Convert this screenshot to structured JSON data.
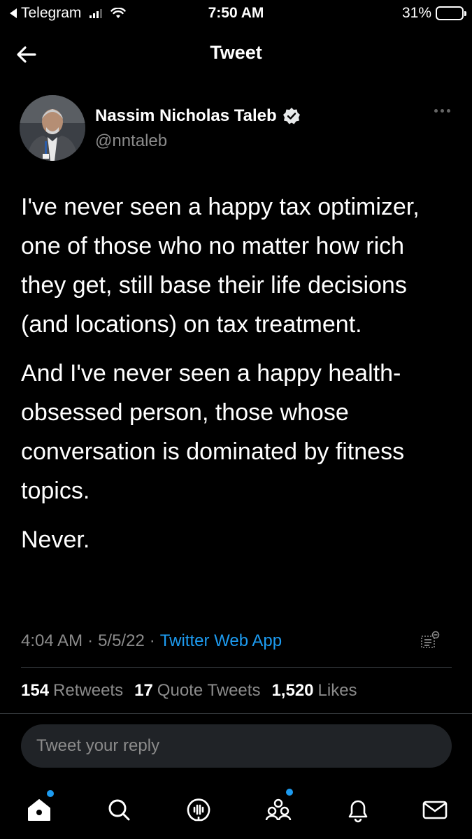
{
  "status_bar": {
    "back_app": "Telegram",
    "time": "7:50 AM",
    "battery": "31%",
    "battery_level": 0.31,
    "signal_bars": 3
  },
  "nav": {
    "title": "Tweet",
    "back_icon": "arrow-left-icon"
  },
  "author": {
    "name": "Nassim Nicholas Taleb",
    "handle": "@nntaleb",
    "verified": true
  },
  "tweet": {
    "paragraphs": [
      "I've never seen a happy tax optimizer, one of those who no matter how rich they get, still base their life decisions (and locations) on tax treatment.",
      "And I've never seen a happy health-obsessed person, those whose conversation is dominated by fitness topics.",
      "Never."
    ],
    "time": "4:04 AM",
    "date": "5/5/22",
    "source": "Twitter Web App",
    "separator": "·"
  },
  "stats": {
    "retweets_count": "154",
    "retweets_label": "Retweets",
    "quotes_count": "17",
    "quotes_label": "Quote Tweets",
    "likes_count": "1,520",
    "likes_label": "Likes"
  },
  "reply": {
    "placeholder": "Tweet your reply"
  },
  "tabs": [
    {
      "icon": "home-icon",
      "has_dot": true
    },
    {
      "icon": "search-icon",
      "has_dot": false
    },
    {
      "icon": "spaces-icon",
      "has_dot": false
    },
    {
      "icon": "communities-icon",
      "has_dot": true
    },
    {
      "icon": "notifications-icon",
      "has_dot": false
    },
    {
      "icon": "messages-icon",
      "has_dot": false
    }
  ],
  "colors": {
    "background": "#000000",
    "accent": "#1d9bf0",
    "secondary_text": "#8b8b8b",
    "divider": "#2f3336"
  }
}
